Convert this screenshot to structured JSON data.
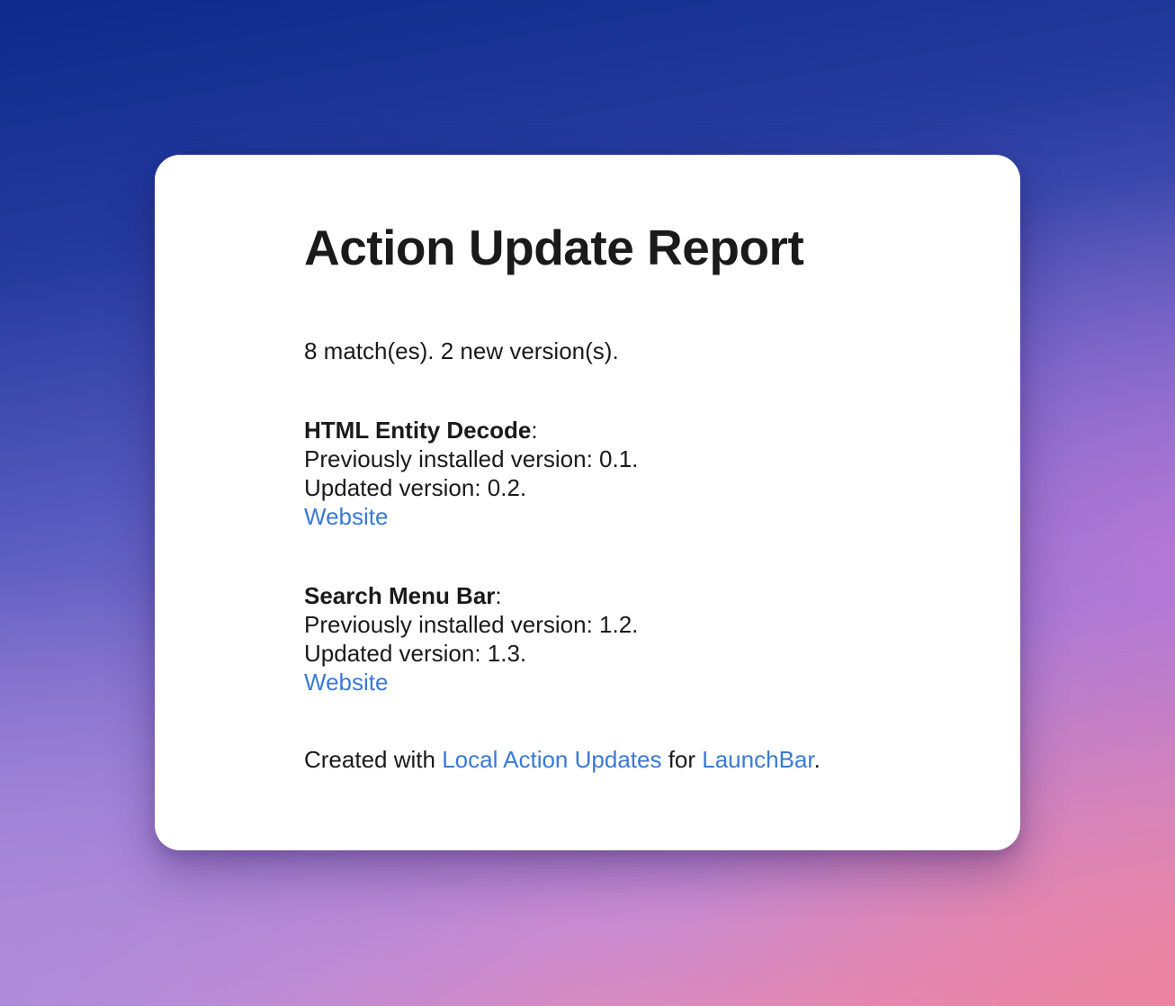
{
  "report": {
    "title": "Action Update Report",
    "summary": "8 match(es). 2 new version(s).",
    "entries": [
      {
        "name": "HTML Entity Decode",
        "previous": "Previously installed version: 0.1.",
        "updated": "Updated version: 0.2.",
        "link_label": "Website"
      },
      {
        "name": "Search Menu Bar",
        "previous": "Previously installed version: 1.2.",
        "updated": "Updated version: 1.3.",
        "link_label": "Website"
      }
    ],
    "footer": {
      "prefix": "Created with ",
      "link1": "Local Action Updates",
      "middle": " for ",
      "link2": "LaunchBar",
      "suffix": "."
    }
  },
  "colors": {
    "link": "#3a7ad4",
    "text": "#1a1a1a",
    "card": "#ffffff"
  }
}
